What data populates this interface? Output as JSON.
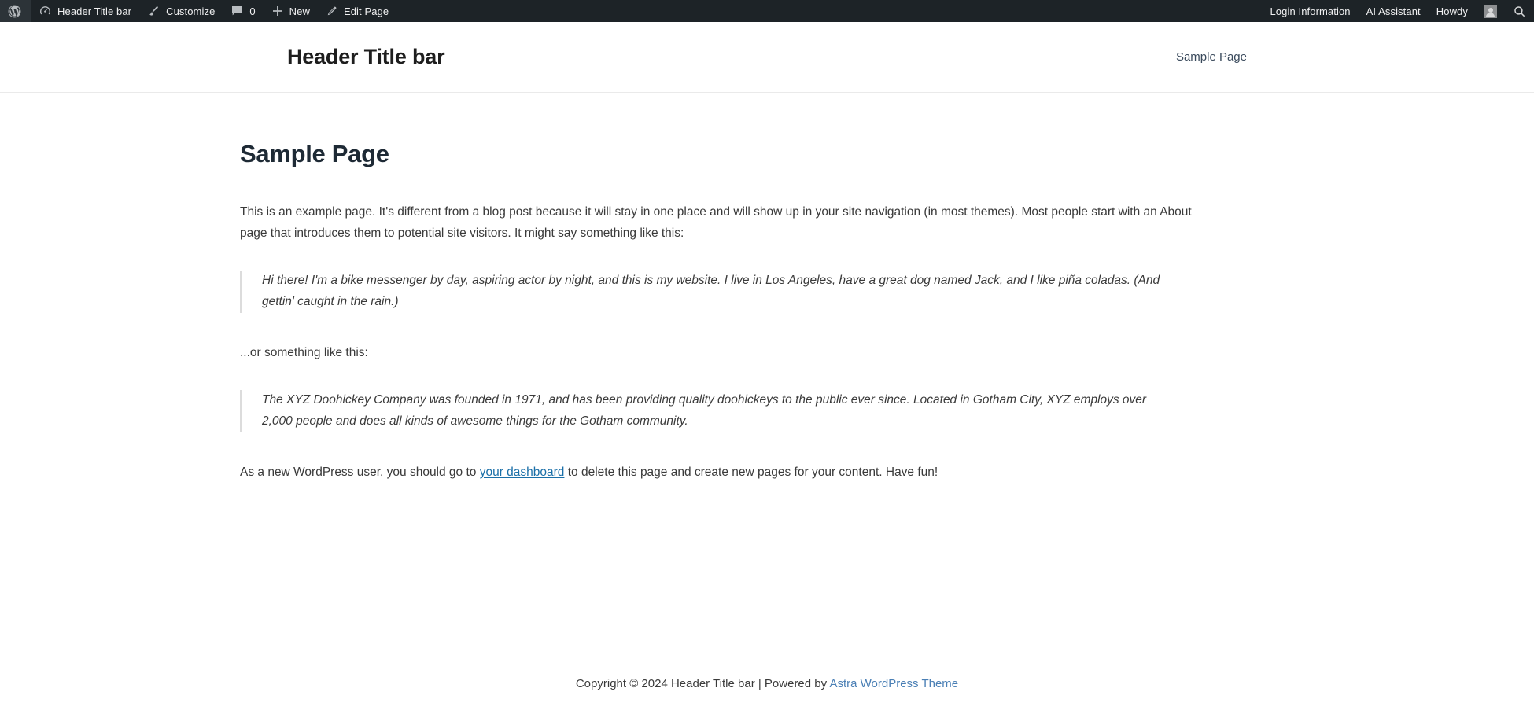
{
  "admin_bar": {
    "left_items": [
      {
        "id": "wp-logo",
        "icon": "wordpress-logo-icon",
        "label": ""
      },
      {
        "id": "site-name",
        "icon": "dashboard-speedometer-icon",
        "label": "Header Title bar"
      },
      {
        "id": "customize",
        "icon": "paintbrush-icon",
        "label": "Customize"
      },
      {
        "id": "comments",
        "icon": "comment-bubble-icon",
        "label": "",
        "count": "0"
      },
      {
        "id": "new-content",
        "icon": "plus-icon",
        "label": "New"
      },
      {
        "id": "edit-page",
        "icon": "pencil-icon",
        "label": "Edit Page"
      }
    ],
    "right_items": [
      {
        "id": "login-information",
        "label": "Login Information"
      },
      {
        "id": "ai-assistant",
        "label": "AI Assistant"
      },
      {
        "id": "my-account",
        "label": "Howdy",
        "icon": "user-avatar-icon"
      },
      {
        "id": "search",
        "label": "",
        "icon": "search-icon"
      }
    ],
    "background_color": "#1d2327",
    "text_color": "#f0f0f1"
  },
  "site_header": {
    "title": "Header Title bar",
    "nav": [
      {
        "id": "sample-page",
        "label": "Sample Page"
      }
    ]
  },
  "main": {
    "page_title": "Sample Page",
    "intro_paragraph": "This is an example page. It's different from a blog post because it will stay in one place and will show up in your site navigation (in most themes). Most people start with an About page that introduces them to potential site visitors. It might say something like this:",
    "quote_one": "Hi there! I'm a bike messenger by day, aspiring actor by night, and this is my website. I live in Los Angeles, have a great dog named Jack, and I like piña coladas. (And gettin' caught in the rain.)",
    "bridge_paragraph": "...or something like this:",
    "quote_two": "The XYZ Doohickey Company was founded in 1971, and has been providing quality doohickeys to the public ever since. Located in Gotham City, XYZ employs over 2,000 people and does all kinds of awesome things for the Gotham community.",
    "closing": {
      "before_link": "As a new WordPress user, you should go to ",
      "link_text": "your dashboard",
      "after_link": " to delete this page and create new pages for your content. Have fun!"
    }
  },
  "footer": {
    "copyright_text": "Copyright © 2024 Header Title bar | Powered by ",
    "theme_link": "Astra WordPress Theme"
  },
  "colors": {
    "admin_bar_bg": "#1d2327",
    "page_bg": "#ffffff",
    "body_text": "#3a3a3a",
    "heading": "#1e2a35",
    "link": "#1a6fa8",
    "nav_link": "#3a4a5c",
    "footer_link": "#4a7fb5",
    "blockquote_border": "#dcdcdc",
    "divider": "#eaeaea"
  }
}
